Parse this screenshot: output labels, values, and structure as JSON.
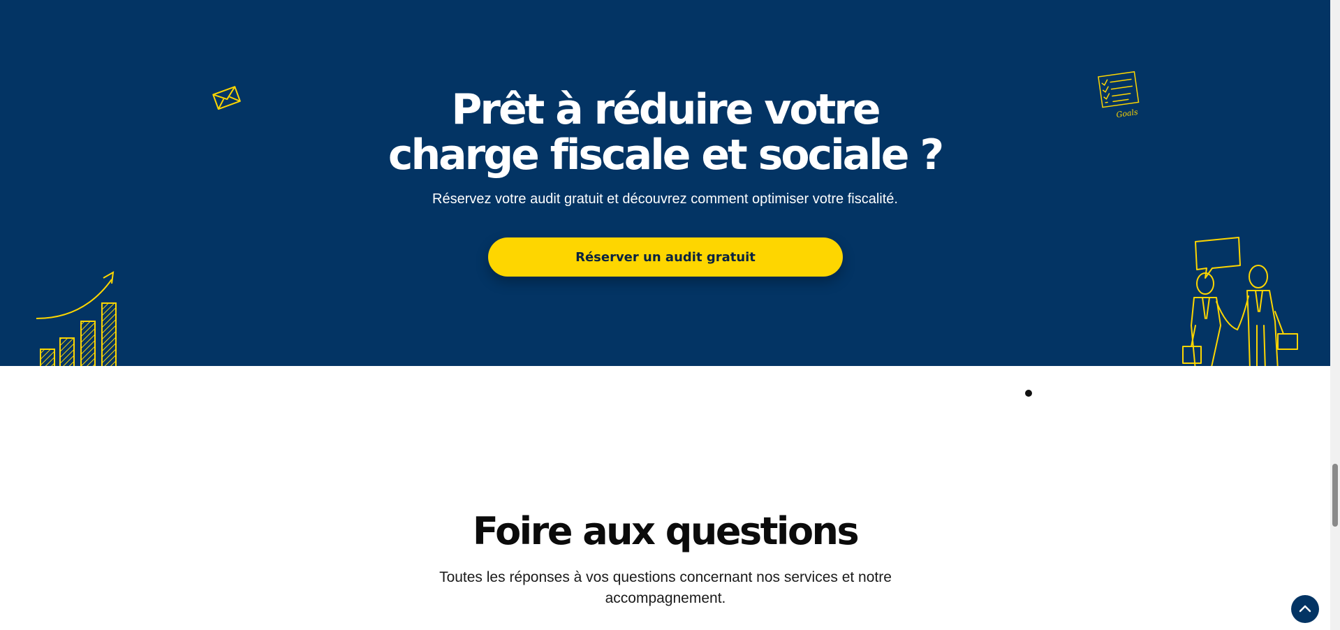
{
  "cta": {
    "title_line1": "Prêt à réduire votre",
    "title_line2": "charge fiscale et sociale ?",
    "subtitle": "Réservez votre audit gratuit et découvrez comment optimiser votre fiscalité.",
    "button_label": "Réserver un audit gratuit",
    "illustration_label": "Goals"
  },
  "faq": {
    "title": "Foire aux questions",
    "subtitle": "Toutes les réponses à vos questions concernant nos services et notre accompagnement."
  },
  "icons": {
    "envelope": "envelope-icon",
    "checklist": "goals-checklist-icon",
    "growth_chart": "growth-chart-icon",
    "handshake": "business-handshake-icon",
    "back_to_top": "chevron-up-icon"
  },
  "colors": {
    "cta_background": "#033464",
    "accent": "#fed600",
    "button_text": "#0a2340"
  }
}
